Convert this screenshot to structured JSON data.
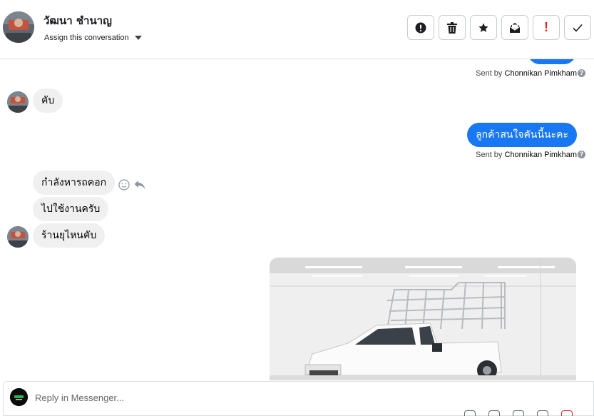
{
  "header": {
    "contact_name": "วัฒนา ชำนาญ",
    "assign_label": "Assign this conversation",
    "toolbar": [
      {
        "name": "spam-button",
        "icon": "alert-circle-icon"
      },
      {
        "name": "delete-button",
        "icon": "trash-icon"
      },
      {
        "name": "star-button",
        "icon": "star-icon"
      },
      {
        "name": "mark-unread-button",
        "icon": "envelope-open-icon"
      },
      {
        "name": "follow-up-button",
        "label": "!",
        "icon": "exclamation-icon"
      },
      {
        "name": "mark-done-button",
        "icon": "checkmark-icon"
      }
    ]
  },
  "conversation": {
    "sent_by_prefix": "Sent by",
    "agent_name": "Chonnikan Pimkham",
    "messages": [
      {
        "direction": "in",
        "text": "คับ"
      },
      {
        "direction": "out",
        "text": "ลูกค้าสนใจคันนี้นะคะ"
      },
      {
        "direction": "in",
        "text": "กำลังหารถคอก"
      },
      {
        "direction": "in",
        "text": "ไปใช้งานครับ"
      },
      {
        "direction": "in",
        "text": "ร้านยุไหนคับ"
      }
    ]
  },
  "composer": {
    "placeholder": "Reply in Messenger..."
  },
  "colors": {
    "accent": "#1877f2",
    "bubble_in": "#f0f0f0",
    "border": "#dadde1",
    "danger": "#e4262c"
  }
}
